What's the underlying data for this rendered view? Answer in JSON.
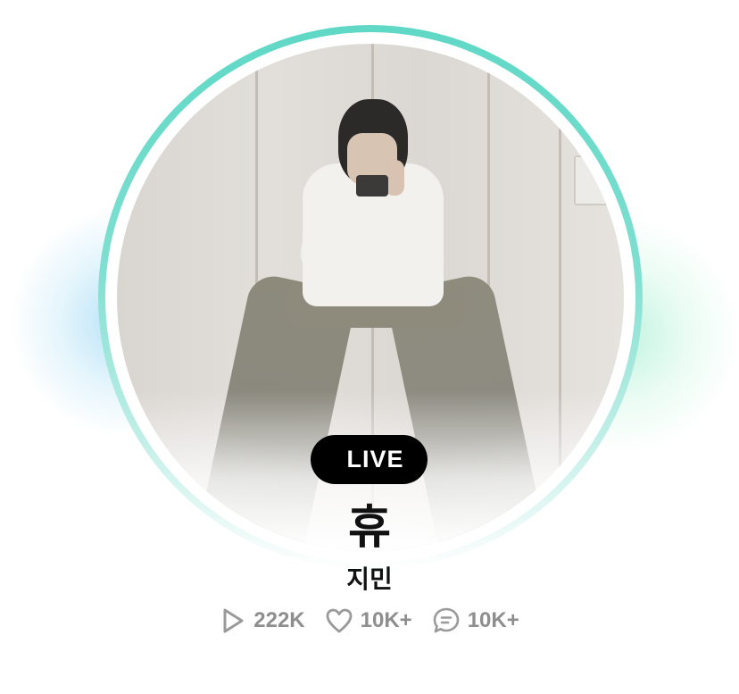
{
  "profile": {
    "live_label": "LIVE",
    "title": "휴",
    "subtitle": "지민",
    "avatar_alt": "profile photo",
    "ring_color": "#5fd8c6"
  },
  "stats": {
    "plays": {
      "icon": "play-icon",
      "value": "222K"
    },
    "likes": {
      "icon": "heart-icon",
      "value": "10K+"
    },
    "comments": {
      "icon": "comment-icon",
      "value": "10K+"
    }
  },
  "colors": {
    "stat_text": "#8e8e8e",
    "badge_bg": "#000000",
    "glow_left": "#78c8f0",
    "glow_right": "#96ebc8"
  }
}
